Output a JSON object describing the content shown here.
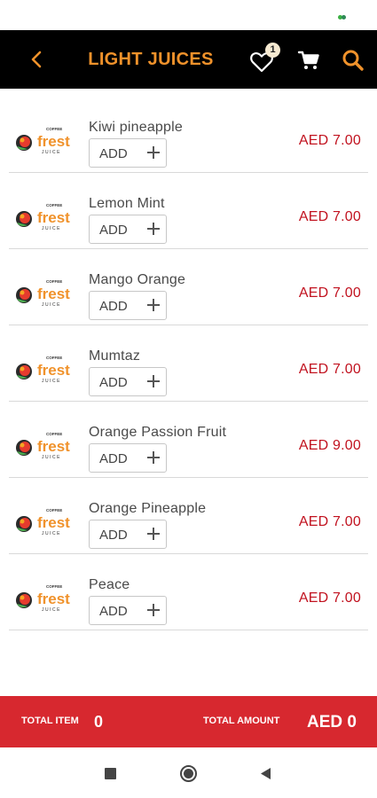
{
  "header": {
    "title": "LIGHT JUICES",
    "wishlist_count": "1",
    "icons": {
      "back": "chevron-left-icon",
      "wishlist": "heart-icon",
      "cart": "cart-icon",
      "search": "search-icon"
    },
    "accent_color": "#f0922b",
    "background_color": "#000000"
  },
  "products": [
    {
      "name": "Kiwi pineapple",
      "price": "AED 7.00",
      "add_label": "ADD"
    },
    {
      "name": "Lemon Mint",
      "price": "AED 7.00",
      "add_label": "ADD"
    },
    {
      "name": "Mango Orange",
      "price": "AED 7.00",
      "add_label": "ADD"
    },
    {
      "name": "Mumtaz",
      "price": "AED 7.00",
      "add_label": "ADD"
    },
    {
      "name": "Orange Passion Fruit",
      "price": "AED 9.00",
      "add_label": "ADD"
    },
    {
      "name": "Orange Pineapple",
      "price": "AED 7.00",
      "add_label": "ADD"
    },
    {
      "name": "Peace",
      "price": "AED 7.00",
      "add_label": "ADD"
    }
  ],
  "logo": {
    "brand_small": "COFFEE",
    "brand_main": "frest",
    "brand_sub": "JUICE"
  },
  "footer": {
    "total_item_label": "TOTAL ITEM",
    "total_item_value": "0",
    "total_amount_label": "TOTAL AMOUNT",
    "total_amount_value": "AED 0",
    "background_color": "#d7282f"
  },
  "colors": {
    "price": "#c1121f"
  }
}
